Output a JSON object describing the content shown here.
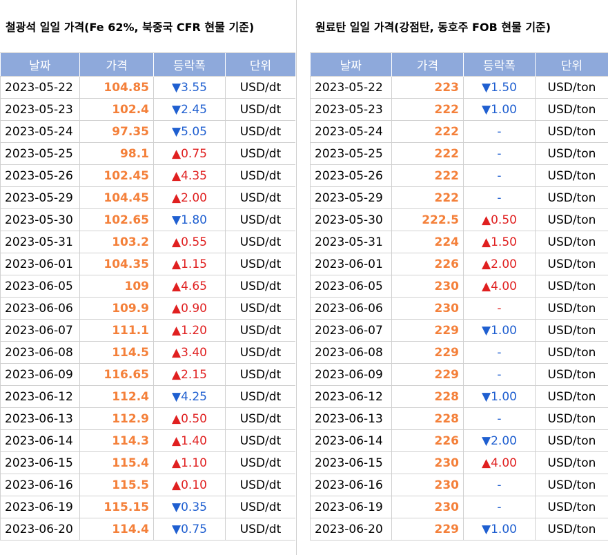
{
  "left": {
    "title": "철광석 일일 가격(Fe 62%, 북중국 CFR 현물 기준)",
    "headers": [
      "날짜",
      "가격",
      "등락폭",
      "단위"
    ],
    "rows": [
      {
        "date": "2023-05-22",
        "price": "104.85",
        "dir": "down",
        "change": "3.55",
        "unit": "USD/dt"
      },
      {
        "date": "2023-05-23",
        "price": "102.4",
        "dir": "down",
        "change": "2.45",
        "unit": "USD/dt"
      },
      {
        "date": "2023-05-24",
        "price": "97.35",
        "dir": "down",
        "change": "5.05",
        "unit": "USD/dt"
      },
      {
        "date": "2023-05-25",
        "price": "98.1",
        "dir": "up",
        "change": "0.75",
        "unit": "USD/dt"
      },
      {
        "date": "2023-05-26",
        "price": "102.45",
        "dir": "up",
        "change": "4.35",
        "unit": "USD/dt"
      },
      {
        "date": "2023-05-29",
        "price": "104.45",
        "dir": "up",
        "change": "2.00",
        "unit": "USD/dt"
      },
      {
        "date": "2023-05-30",
        "price": "102.65",
        "dir": "down",
        "change": "1.80",
        "unit": "USD/dt"
      },
      {
        "date": "2023-05-31",
        "price": "103.2",
        "dir": "up",
        "change": "0.55",
        "unit": "USD/dt"
      },
      {
        "date": "2023-06-01",
        "price": "104.35",
        "dir": "up",
        "change": "1.15",
        "unit": "USD/dt"
      },
      {
        "date": "2023-06-05",
        "price": "109",
        "dir": "up",
        "change": "4.65",
        "unit": "USD/dt"
      },
      {
        "date": "2023-06-06",
        "price": "109.9",
        "dir": "up",
        "change": "0.90",
        "unit": "USD/dt"
      },
      {
        "date": "2023-06-07",
        "price": "111.1",
        "dir": "up",
        "change": "1.20",
        "unit": "USD/dt"
      },
      {
        "date": "2023-06-08",
        "price": "114.5",
        "dir": "up",
        "change": "3.40",
        "unit": "USD/dt"
      },
      {
        "date": "2023-06-09",
        "price": "116.65",
        "dir": "up",
        "change": "2.15",
        "unit": "USD/dt"
      },
      {
        "date": "2023-06-12",
        "price": "112.4",
        "dir": "down",
        "change": "4.25",
        "unit": "USD/dt"
      },
      {
        "date": "2023-06-13",
        "price": "112.9",
        "dir": "up",
        "change": "0.50",
        "unit": "USD/dt"
      },
      {
        "date": "2023-06-14",
        "price": "114.3",
        "dir": "up",
        "change": "1.40",
        "unit": "USD/dt"
      },
      {
        "date": "2023-06-15",
        "price": "115.4",
        "dir": "up",
        "change": "1.10",
        "unit": "USD/dt"
      },
      {
        "date": "2023-06-16",
        "price": "115.5",
        "dir": "up",
        "change": "0.10",
        "unit": "USD/dt"
      },
      {
        "date": "2023-06-19",
        "price": "115.15",
        "dir": "down",
        "change": "0.35",
        "unit": "USD/dt"
      },
      {
        "date": "2023-06-20",
        "price": "114.4",
        "dir": "down",
        "change": "0.75",
        "unit": "USD/dt"
      }
    ]
  },
  "right": {
    "title": "원료탄 일일 가격(강점탄, 동호주 FOB 현물 기준)",
    "headers": [
      "날짜",
      "가격",
      "등락폭",
      "단위"
    ],
    "rows": [
      {
        "date": "2023-05-22",
        "price": "223",
        "dir": "down",
        "change": "1.50",
        "unit": "USD/ton"
      },
      {
        "date": "2023-05-23",
        "price": "222",
        "dir": "down",
        "change": "1.00",
        "unit": "USD/ton"
      },
      {
        "date": "2023-05-24",
        "price": "222",
        "dir": "flat",
        "change": "-",
        "unit": "USD/ton"
      },
      {
        "date": "2023-05-25",
        "price": "222",
        "dir": "flat",
        "change": "-",
        "unit": "USD/ton"
      },
      {
        "date": "2023-05-26",
        "price": "222",
        "dir": "flat",
        "change": "-",
        "unit": "USD/ton"
      },
      {
        "date": "2023-05-29",
        "price": "222",
        "dir": "flat",
        "change": "-",
        "unit": "USD/ton"
      },
      {
        "date": "2023-05-30",
        "price": "222.5",
        "dir": "up",
        "change": "0.50",
        "unit": "USD/ton"
      },
      {
        "date": "2023-05-31",
        "price": "224",
        "dir": "up",
        "change": "1.50",
        "unit": "USD/ton"
      },
      {
        "date": "2023-06-01",
        "price": "226",
        "dir": "up",
        "change": "2.00",
        "unit": "USD/ton"
      },
      {
        "date": "2023-06-05",
        "price": "230",
        "dir": "up",
        "change": "4.00",
        "unit": "USD/ton"
      },
      {
        "date": "2023-06-06",
        "price": "230",
        "dir": "flat_red",
        "change": "-",
        "unit": "USD/ton"
      },
      {
        "date": "2023-06-07",
        "price": "229",
        "dir": "down",
        "change": "1.00",
        "unit": "USD/ton"
      },
      {
        "date": "2023-06-08",
        "price": "229",
        "dir": "flat",
        "change": "-",
        "unit": "USD/ton"
      },
      {
        "date": "2023-06-09",
        "price": "229",
        "dir": "flat",
        "change": "-",
        "unit": "USD/ton"
      },
      {
        "date": "2023-06-12",
        "price": "228",
        "dir": "down",
        "change": "1.00",
        "unit": "USD/ton"
      },
      {
        "date": "2023-06-13",
        "price": "228",
        "dir": "flat",
        "change": "-",
        "unit": "USD/ton"
      },
      {
        "date": "2023-06-14",
        "price": "226",
        "dir": "down",
        "change": "2.00",
        "unit": "USD/ton"
      },
      {
        "date": "2023-06-15",
        "price": "230",
        "dir": "up",
        "change": "4.00",
        "unit": "USD/ton"
      },
      {
        "date": "2023-06-16",
        "price": "230",
        "dir": "flat",
        "change": "-",
        "unit": "USD/ton"
      },
      {
        "date": "2023-06-19",
        "price": "230",
        "dir": "flat",
        "change": "-",
        "unit": "USD/ton"
      },
      {
        "date": "2023-06-20",
        "price": "229",
        "dir": "down",
        "change": "1.00",
        "unit": "USD/ton"
      }
    ]
  },
  "symbols": {
    "up": "▲",
    "down": "▼"
  },
  "colors": {
    "header_bg": "#8ea9db",
    "price": "#f4803a",
    "up": "#e02020",
    "down": "#1f5fd0"
  }
}
